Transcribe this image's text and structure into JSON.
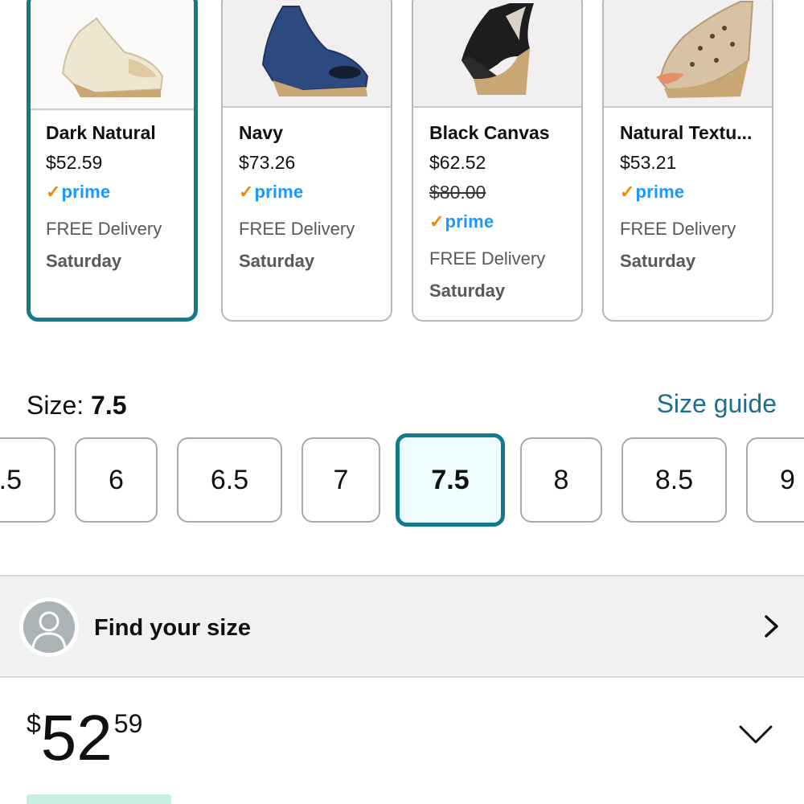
{
  "variants": [
    {
      "name": "Dark Natural",
      "price": "$52.59",
      "list_price": "",
      "prime": "prime",
      "delivery": "FREE Delivery",
      "delivery_day": "Saturday",
      "selected": true,
      "color": "#efe6d2"
    },
    {
      "name": "Navy",
      "price": "$73.26",
      "list_price": "",
      "prime": "prime",
      "delivery": "FREE Delivery",
      "delivery_day": "Saturday",
      "selected": false,
      "color": "#2d4a80"
    },
    {
      "name": "Black Canvas",
      "price": "$62.52",
      "list_price": "$80.00",
      "prime": "prime",
      "delivery": "FREE Delivery",
      "delivery_day": "Saturday",
      "selected": false,
      "color": "#1d1d1f"
    },
    {
      "name": "Natural Textu...",
      "price": "$53.21",
      "list_price": "",
      "prime": "prime",
      "delivery": "FREE Delivery",
      "delivery_day": "Saturday",
      "selected": false,
      "color": "#d8c2a4"
    }
  ],
  "size": {
    "label": "Size: ",
    "selected": "7.5",
    "guide_link": "Size guide",
    "options": [
      ".5",
      "6",
      "6.5",
      "7",
      "7.5",
      "8",
      "8.5",
      "9"
    ]
  },
  "find_size": {
    "label": "Find your size",
    "icon": "person-icon"
  },
  "price": {
    "symbol": "$",
    "whole": "52",
    "fraction": "59"
  },
  "colors": {
    "accent": "#127a8a",
    "link": "#1f6e8c",
    "prime_blue": "#1a98ff",
    "prime_check": "#f08804"
  }
}
